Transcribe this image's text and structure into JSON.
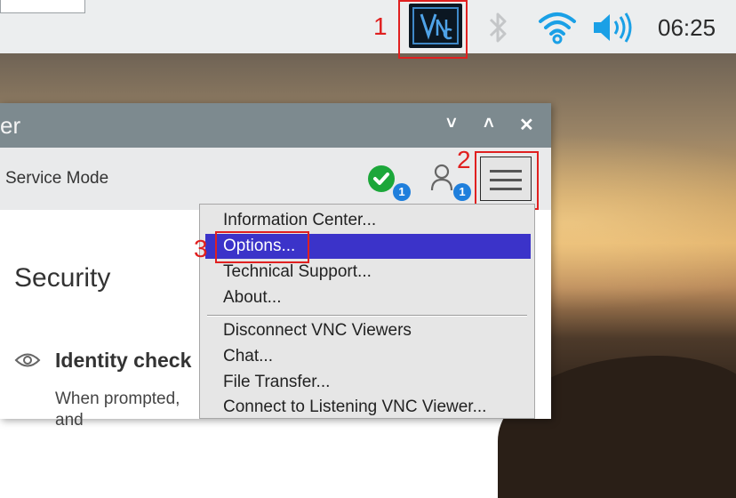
{
  "taskbar": {
    "clock": "06:25",
    "icons": [
      "vnc-icon",
      "bluetooth-icon",
      "wifi-icon",
      "volume-icon"
    ]
  },
  "annotations": {
    "n1": "1",
    "n2": "2",
    "n3": "3"
  },
  "window": {
    "title_partial": "er",
    "toolbar_text": "Service Mode",
    "status_badge": "1",
    "users_badge": "1",
    "heading": "Security",
    "identity_label": "Identity check",
    "prompt_line1": "When prompted,",
    "prompt_line2": "and ",
    "controls": {
      "minimize": "˅",
      "maximize": "˄",
      "close": "✕"
    }
  },
  "menu": {
    "items_top": [
      "Information Center...",
      "Options...",
      "Technical Support...",
      "About..."
    ],
    "items_bottom": [
      "Disconnect VNC Viewers",
      "Chat...",
      "File Transfer...",
      "Connect to Listening VNC Viewer..."
    ],
    "selected_index": 1
  },
  "colors": {
    "menu_highlight": "#3b33c9",
    "annotation": "#e02020",
    "titlebar": "#7d8a8f",
    "badge": "#1f7fdc",
    "status_ok": "#1ca73a"
  }
}
